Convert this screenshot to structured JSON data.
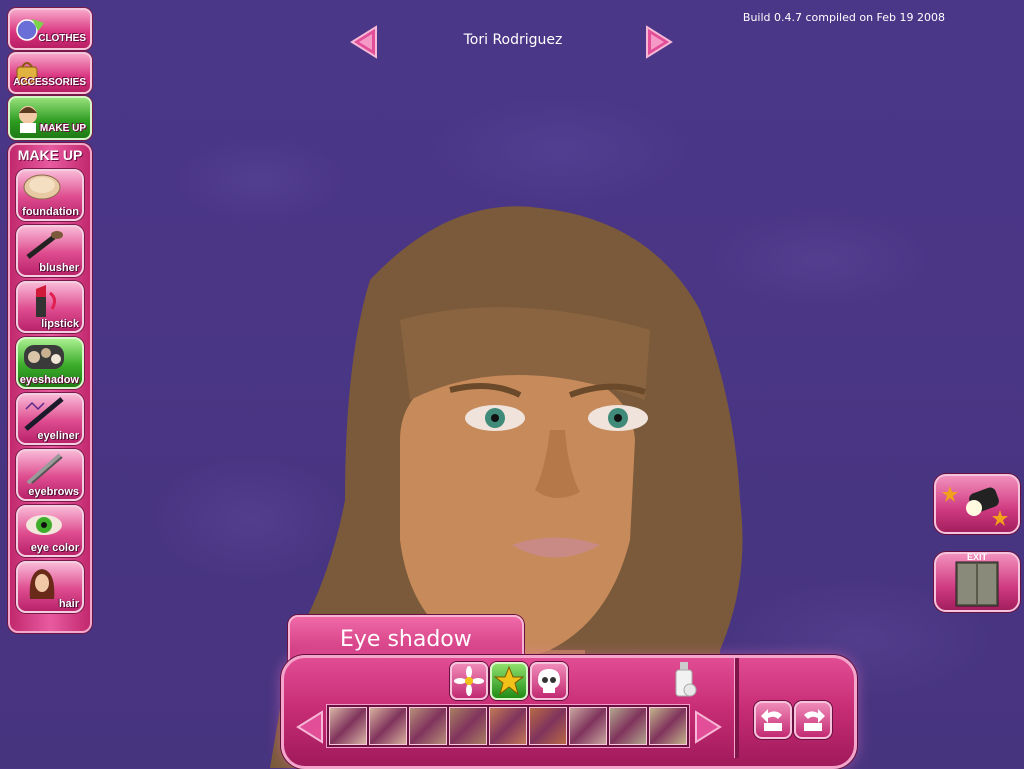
{
  "build_info": "Build 0.4.7 compiled on Feb 19 2008",
  "character_name": "Tori Rodriguez",
  "tabs": [
    {
      "label": "CLOTHES",
      "icon": "clothes-icon"
    },
    {
      "label": "ACCESSORIES",
      "icon": "accessories-icon"
    },
    {
      "label": "MAKE UP",
      "icon": "makeup-icon",
      "active": true
    }
  ],
  "makeup_panel": {
    "title": "MAKE UP",
    "items": [
      {
        "label": "foundation",
        "icon": "foundation-icon"
      },
      {
        "label": "blusher",
        "icon": "blusher-icon"
      },
      {
        "label": "lipstick",
        "icon": "lipstick-icon"
      },
      {
        "label": "eyeshadow",
        "icon": "eyeshadow-icon",
        "active": true
      },
      {
        "label": "eyeliner",
        "icon": "eyeliner-icon"
      },
      {
        "label": "eyebrows",
        "icon": "eyebrows-icon"
      },
      {
        "label": "eye color",
        "icon": "eye-color-icon"
      },
      {
        "label": "hair",
        "icon": "hair-icon"
      }
    ]
  },
  "editor": {
    "title": "Eye shadow",
    "modes": [
      "flower-icon",
      "star-icon",
      "skull-icon"
    ],
    "active_mode": "star-icon",
    "swatches": [
      "#d9b5a5",
      "#d8b09e",
      "#b8907a",
      "#a98063",
      "#c27a57",
      "#b86a45",
      "#c9a7a0",
      "#b3a68e",
      "#c3b38a"
    ]
  },
  "exit_label": "EXIT",
  "colors": {
    "accent_pink": "#d9347f",
    "active_green": "#2b9a1f",
    "background": "#4a3585"
  }
}
